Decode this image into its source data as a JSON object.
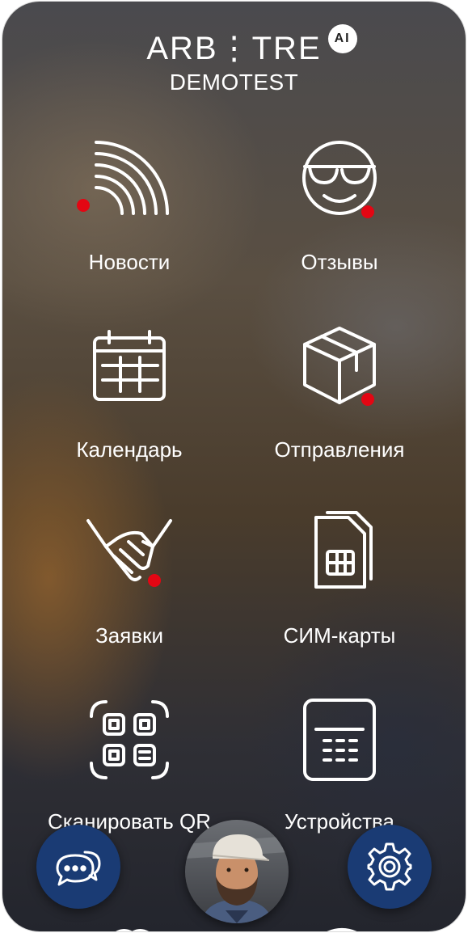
{
  "header": {
    "logo": "ARB⋮TRE",
    "ai_badge": "AI",
    "subtitle": "DEMOTEST"
  },
  "tiles": [
    {
      "label": "Новости",
      "icon": "rss-icon",
      "badge": true
    },
    {
      "label": "Отзывы",
      "icon": "sunglasses-smiley-icon",
      "badge": true
    },
    {
      "label": "Календарь",
      "icon": "calendar-icon",
      "badge": false
    },
    {
      "label": "Отправления",
      "icon": "package-box-icon",
      "badge": true
    },
    {
      "label": "Заявки",
      "icon": "handshake-icon",
      "badge": true
    },
    {
      "label": "СИМ-карты",
      "icon": "sim-card-icon",
      "badge": false
    },
    {
      "label": "Сканировать QR",
      "icon": "qr-scan-icon",
      "badge": false
    },
    {
      "label": "Устройства",
      "icon": "device-terminal-icon",
      "badge": false
    }
  ],
  "bottom_bar": {
    "left": "chat-bubbles-icon",
    "center": "user-avatar",
    "right": "gear-icon"
  },
  "colors": {
    "badge": "#e30613",
    "fab": "#1a3b74"
  }
}
